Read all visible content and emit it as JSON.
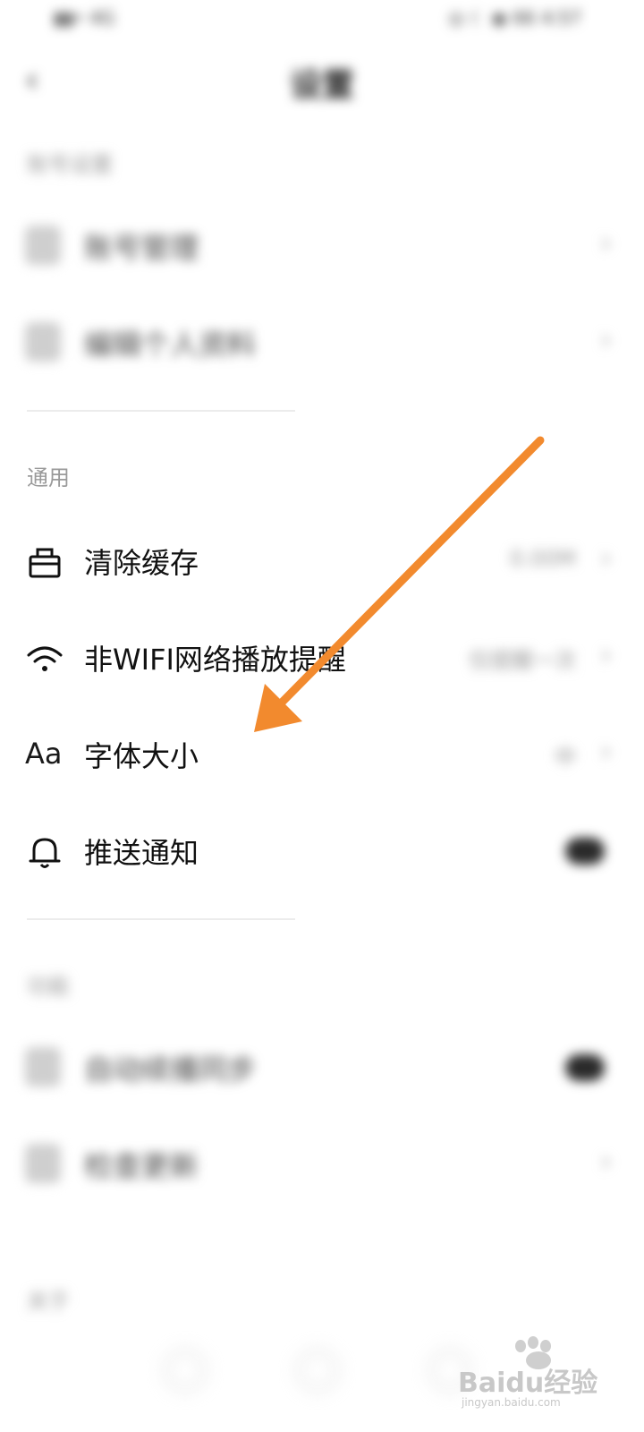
{
  "status_bar": {
    "left": "▮▮• 4G",
    "right": "◎ ☾ ◉ 66 4:57"
  },
  "header": {
    "back_icon": "chevron-left-icon",
    "title": "设置"
  },
  "account_section": {
    "label": "账号设置",
    "items": [
      {
        "label": "账号管理",
        "icon": "user-icon"
      },
      {
        "label": "编辑个人资料",
        "icon": "profile-icon"
      }
    ]
  },
  "general_section": {
    "label": "通用",
    "items": [
      {
        "label": "清除缓存",
        "icon": "trash-icon",
        "value": "0.00M"
      },
      {
        "label": "非WIFI网络播放提醒",
        "icon": "wifi-icon",
        "value": "仅提醒一次"
      },
      {
        "label": "字体大小",
        "icon": "font-size-icon",
        "value": "中"
      },
      {
        "label": "推送通知",
        "icon": "bell-icon",
        "toggle": "on"
      }
    ]
  },
  "feature_section": {
    "label": "功能",
    "items": [
      {
        "label": "自动续播同步",
        "icon": "sync-icon",
        "toggle": "on"
      },
      {
        "label": "检查更新",
        "icon": "update-icon"
      }
    ]
  },
  "about_section": {
    "label": "关于"
  },
  "watermark": {
    "brand": "Baidu经验",
    "url": "jingyan.baidu.com"
  },
  "colors": {
    "arrow": "#F28A2E",
    "toggle_on": "#2a2a2a",
    "section_label": "#9a9a9a"
  }
}
